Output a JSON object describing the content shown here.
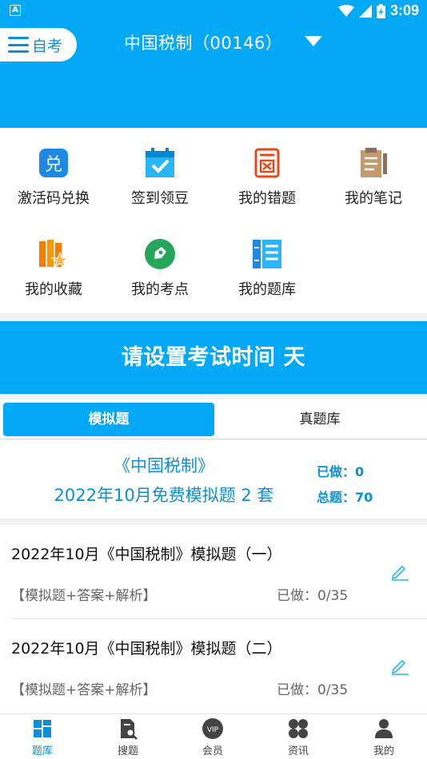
{
  "status_bar": {
    "time": "3:09",
    "notification_icon": "A"
  },
  "header": {
    "exam_type_label": "自考",
    "course_title": "中国税制（00146）",
    "menu_icon": "menu-icon",
    "dropdown_icon": "dropdown-triangle-icon"
  },
  "quick_actions": [
    {
      "label": "激活码兑换",
      "icon": "redeem-icon"
    },
    {
      "label": "签到领豆",
      "icon": "calendar-check-icon"
    },
    {
      "label": "我的错题",
      "icon": "wrong-answers-icon"
    },
    {
      "label": "我的笔记",
      "icon": "notes-icon"
    },
    {
      "label": "我的收藏",
      "icon": "favorites-icon"
    },
    {
      "label": "我的考点",
      "icon": "exam-points-icon"
    },
    {
      "label": "我的题库",
      "icon": "question-bank-icon"
    }
  ],
  "banner": {
    "text": "请设置考试时间 天"
  },
  "tabs": {
    "active": "模拟题",
    "inactive": "真题库"
  },
  "summary": {
    "book": "《中国税制》",
    "subtitle": "2022年10月免费模拟题 2 套",
    "done": "已做：0",
    "total": "总题：70"
  },
  "list": [
    {
      "title": "2022年10月《中国税制》模拟题（一）",
      "tag": "【模拟题+答案+解析】",
      "progress": "已做：0/35"
    },
    {
      "title": "2022年10月《中国税制》模拟题（二）",
      "tag": "【模拟题+答案+解析】",
      "progress": "已做：0/35"
    }
  ],
  "bottom_nav": [
    {
      "label": "题库",
      "icon": "question-bank-tab-icon",
      "active": true
    },
    {
      "label": "搜题",
      "icon": "search-question-icon",
      "active": false
    },
    {
      "label": "会员",
      "icon": "vip-icon",
      "active": false
    },
    {
      "label": "资讯",
      "icon": "news-icon",
      "active": false
    },
    {
      "label": "我的",
      "icon": "profile-icon",
      "active": false
    }
  ],
  "colors": {
    "primary": "#03a9f4",
    "accent_text": "#0a8fd8",
    "background": "#f2f2f2"
  }
}
